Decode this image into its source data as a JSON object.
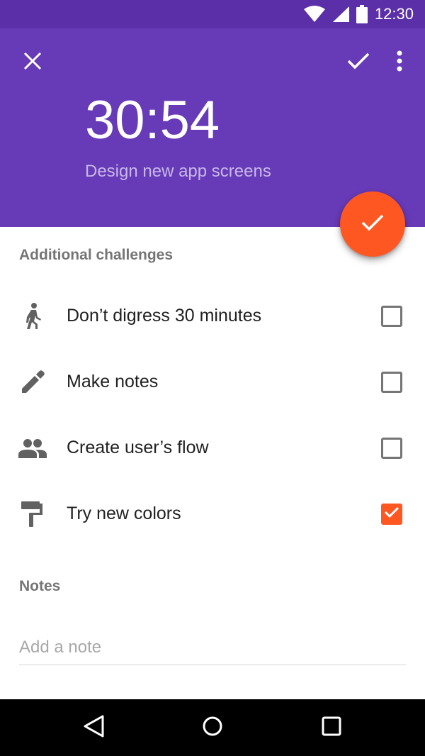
{
  "status_bar": {
    "time": "12:30",
    "icons": [
      "wifi-icon",
      "signal-icon",
      "battery-icon"
    ]
  },
  "header": {
    "timer": "30:54",
    "task_title": "Design new app screens",
    "icons": [
      "close-icon",
      "check-icon",
      "more-vert-icon"
    ]
  },
  "fab": {
    "icon": "check-icon"
  },
  "challenges": {
    "title": "Additional challenges",
    "items": [
      {
        "label": "Don’t digress 30 minutes",
        "icon": "walk-icon",
        "checked": false
      },
      {
        "label": "Make notes",
        "icon": "pencil-icon",
        "checked": false
      },
      {
        "label": "Create user’s flow",
        "icon": "people-icon",
        "checked": false
      },
      {
        "label": "Try new colors",
        "icon": "paint-roller-icon",
        "checked": true
      }
    ]
  },
  "notes": {
    "title": "Notes",
    "placeholder": "Add a note",
    "value": ""
  },
  "nav_bar": {
    "icons": [
      "back-icon",
      "home-icon",
      "recents-icon"
    ]
  },
  "colors": {
    "primary": "#673AB7",
    "primary_dark": "#5A2FA8",
    "accent": "#FF5722"
  }
}
